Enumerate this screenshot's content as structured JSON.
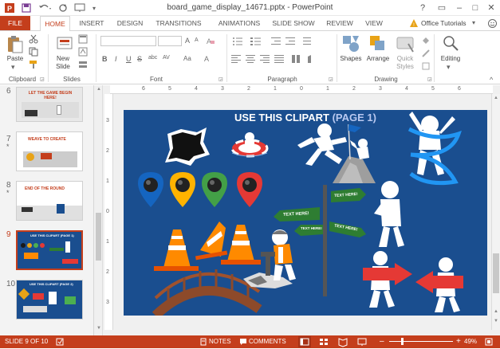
{
  "window": {
    "title": "board_game_display_14671.pptx - PowerPoint",
    "help": "?",
    "restore": "▭",
    "minimize": "–",
    "maximize": "□",
    "close": "✕"
  },
  "quick_access": {
    "app_icon": "powerpoint-icon",
    "save_icon": "save-icon",
    "undo_icon": "undo-icon",
    "redo_icon": "redo-icon",
    "customize_icon": "customize-icon"
  },
  "tabs": [
    {
      "label": "FILE"
    },
    {
      "label": "HOME"
    },
    {
      "label": "INSERT"
    },
    {
      "label": "DESIGN"
    },
    {
      "label": "TRANSITIONS"
    },
    {
      "label": "ANIMATIONS"
    },
    {
      "label": "SLIDE SHOW"
    },
    {
      "label": "REVIEW"
    },
    {
      "label": "VIEW"
    }
  ],
  "account": {
    "label": "Office Tutorials",
    "arrow": "▾",
    "collapse": "^"
  },
  "ribbon": {
    "clipboard": {
      "paste": "Paste",
      "group": "Clipboard"
    },
    "slides": {
      "new_slide": "New",
      "new_slide2": "Slide",
      "group": "Slides"
    },
    "font": {
      "group": "Font",
      "bold": "B",
      "italic": "I",
      "underline": "U",
      "strike": "S",
      "shadow": "abc",
      "spacing": "AV",
      "case": "Aa",
      "grow": "A",
      "shrink": "A",
      "color": "A"
    },
    "paragraph": {
      "group": "Paragraph"
    },
    "drawing": {
      "shapes": "Shapes",
      "arrange": "Arrange",
      "quick_styles": "Quick",
      "quick_styles2": "Styles",
      "group": "Drawing"
    },
    "editing": {
      "label": "Editing"
    }
  },
  "slides_panel": [
    {
      "num": "6",
      "star": ""
    },
    {
      "num": "7",
      "star": "*"
    },
    {
      "num": "8",
      "star": "*"
    },
    {
      "num": "9",
      "star": ""
    },
    {
      "num": "10",
      "star": ""
    }
  ],
  "thumb_titles": {
    "t6": "LET THE GAME BEGIN HERE!",
    "t7": "WEAVE TO CREATE",
    "t8": "END OF THE ROUND",
    "t9": "USE THIS CLIPART (PAGE 1)",
    "t10": "USE THIS CLIPART (PAGE 2)"
  },
  "ruler_marks": [
    "6",
    "5",
    "4",
    "3",
    "2",
    "1",
    "0",
    "1",
    "2",
    "3",
    "4",
    "5",
    "6"
  ],
  "ruler_v_marks": [
    "3",
    "2",
    "1",
    "0",
    "1",
    "2",
    "3"
  ],
  "slide": {
    "title_main": "USE THIS CLIPART ",
    "title_page": "(PAGE 1)",
    "sign1": "TEXT HERE!",
    "sign2": "TEXT HERE!",
    "sign3": "TEXT HERE!",
    "sign4": "TEXT HERE!",
    "bg_color": "#1a4e8f"
  },
  "status": {
    "slide_info": "SLIDE 9 OF 10",
    "notes": "NOTES",
    "comments": "COMMENTS",
    "zoom": "49%",
    "minus": "–",
    "plus": "+"
  },
  "colors": {
    "accent": "#c43e1c"
  }
}
